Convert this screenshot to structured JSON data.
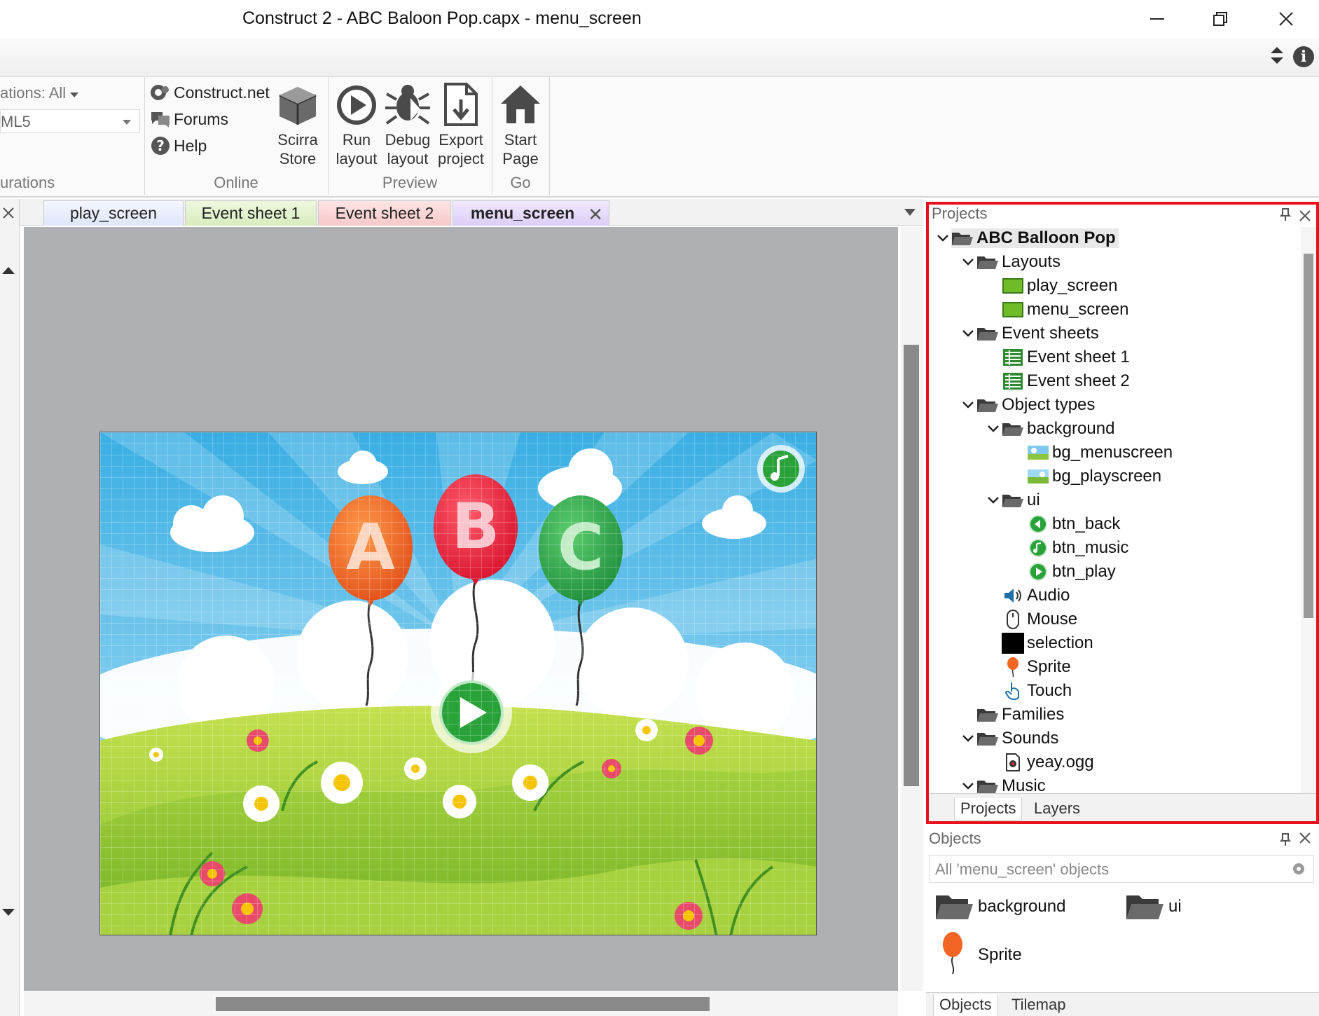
{
  "window": {
    "title": "Construct 2 - ABC Baloon Pop.capx - menu_screen"
  },
  "ribbon": {
    "configurations_combo": "ations: All",
    "export_combo": "ML5",
    "configurations_label": "urations",
    "online": {
      "group_label": "Online",
      "links": [
        "Construct.net",
        "Forums",
        "Help"
      ],
      "store_line1": "Scirra",
      "store_line2": "Store"
    },
    "preview": {
      "group_label": "Preview",
      "run_line1": "Run",
      "run_line2": "layout",
      "debug_line1": "Debug",
      "debug_line2": "layout",
      "export_line1": "Export",
      "export_line2": "project"
    },
    "go": {
      "group_label": "Go",
      "start_line1": "Start",
      "start_line2": "Page"
    }
  },
  "tabs": {
    "play_screen": "play_screen",
    "event_sheet_1": "Event sheet 1",
    "event_sheet_2": "Event sheet 2",
    "menu_screen": "menu_screen",
    "close_glyph": "✕"
  },
  "scene": {
    "balloon_letters": [
      "A",
      "B",
      "C"
    ]
  },
  "projects_panel": {
    "title": "Projects",
    "root": "ABC Balloon Pop",
    "items": [
      "Layouts",
      "play_screen",
      "menu_screen",
      "Event sheets",
      "Event sheet 1",
      "Event sheet 2",
      "Object types",
      "background",
      "bg_menuscreen",
      "bg_playscreen",
      "ui",
      "btn_back",
      "btn_music",
      "btn_play",
      "Audio",
      "Mouse",
      "selection",
      "Sprite",
      "Touch",
      "Families",
      "Sounds",
      "yeay.ogg",
      "Music"
    ],
    "tabs": [
      "Projects",
      "Layers"
    ]
  },
  "objects_panel": {
    "title": "Objects",
    "filter_text": "All 'menu_screen' objects",
    "items": [
      "background",
      "ui",
      "Sprite"
    ],
    "tabs": [
      "Objects",
      "Tilemap"
    ]
  },
  "colors": {
    "highlight_border": "#e8101a",
    "balloon_a": "#f26522",
    "balloon_b": "#e8243c",
    "balloon_c": "#2ea34a"
  }
}
